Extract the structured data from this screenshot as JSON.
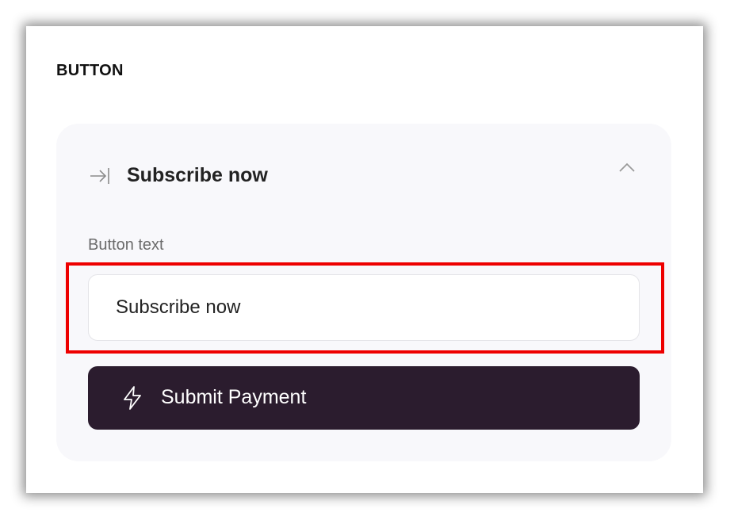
{
  "section": {
    "title": "BUTTON"
  },
  "card": {
    "title": "Subscribe now",
    "collapse_icon": "arrow-to-line-icon",
    "chevron_icon": "chevron-up-icon"
  },
  "field": {
    "label": "Button text",
    "value": "Subscribe now"
  },
  "preview_button": {
    "label": "Submit Payment",
    "icon": "lightning-bolt-icon",
    "background": "#2b1c2e"
  },
  "colors": {
    "highlight": "#ee0000",
    "card_background": "#f8f8fb"
  }
}
